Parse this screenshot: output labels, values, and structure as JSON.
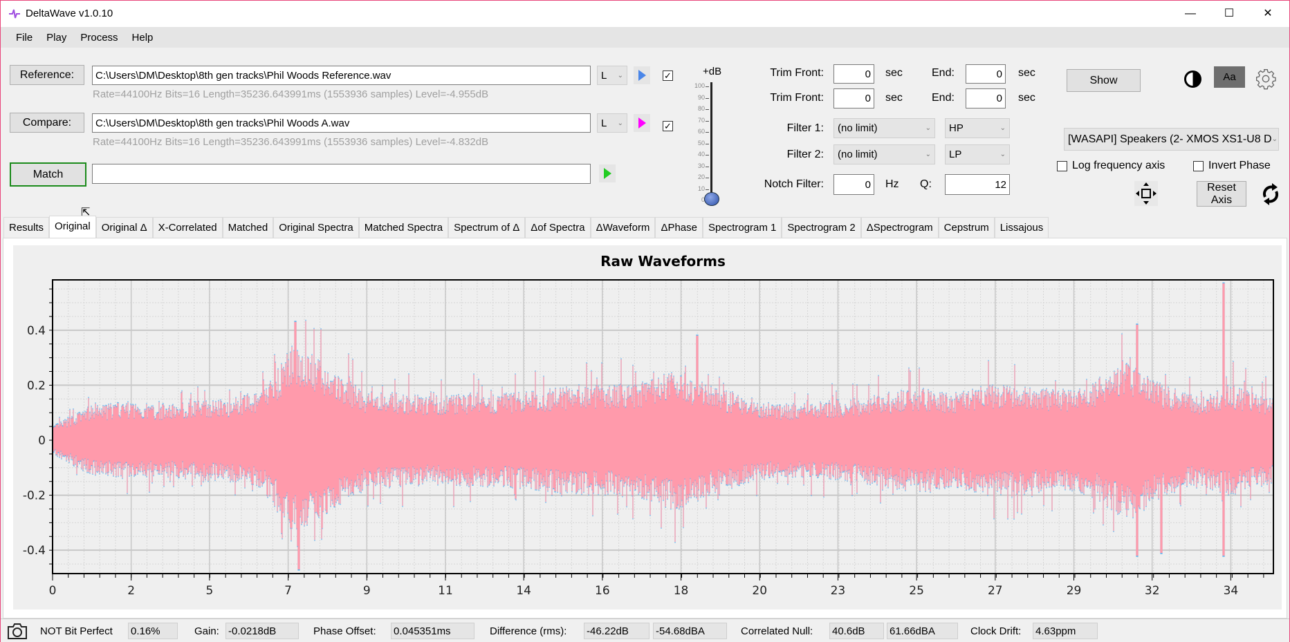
{
  "window": {
    "title": "DeltaWave v1.0.10",
    "minimize": "—",
    "maximize": "☐",
    "close": "✕"
  },
  "menu": [
    "File",
    "Play",
    "Process",
    "Help"
  ],
  "reference": {
    "button": "Reference:",
    "path": "C:\\Users\\DM\\Desktop\\8th gen tracks\\Phil Woods Reference.wav",
    "channel": "L",
    "info": "Rate=44100Hz Bits=16 Length=35236.643991ms (1553936 samples) Level=-4.955dB",
    "checked": true,
    "play_color": "#4a86e8"
  },
  "compare": {
    "button": "Compare:",
    "path": "C:\\Users\\DM\\Desktop\\8th gen tracks\\Phil Woods A.wav",
    "channel": "L",
    "info": "Rate=44100Hz Bits=16 Length=35236.643991ms (1553936 samples) Level=-4.832dB",
    "checked": true,
    "play_color": "#ff00ff"
  },
  "match": {
    "button": "Match",
    "value": "",
    "play_color": "#22cc22"
  },
  "gain_slider": {
    "label": "+dB",
    "ticks": [
      "100",
      "90",
      "80",
      "70",
      "60",
      "50",
      "40",
      "30",
      "20",
      "10",
      "0"
    ],
    "value": 0
  },
  "trim": [
    {
      "label": "Trim Front:",
      "front": "0",
      "unit": "sec",
      "end_label": "End:",
      "end": "0",
      "end_unit": "sec"
    },
    {
      "label": "Trim Front:",
      "front": "0",
      "unit": "sec",
      "end_label": "End:",
      "end": "0",
      "end_unit": "sec"
    }
  ],
  "filter1": {
    "label": "Filter 1:",
    "value": "(no limit)",
    "type": "HP"
  },
  "filter2": {
    "label": "Filter 2:",
    "value": "(no limit)",
    "type": "LP"
  },
  "notch": {
    "label": "Notch Filter:",
    "value": "0",
    "unit": "Hz",
    "q_label": "Q:",
    "q": "12"
  },
  "show_button": "Show",
  "font_button": "Aa",
  "device": "[WASAPI] Speakers (2- XMOS XS1-U8 D",
  "log_freq": {
    "label": "Log frequency axis",
    "checked": false
  },
  "invert_phase": {
    "label": "Invert Phase",
    "checked": false
  },
  "reset_axis": "Reset Axis",
  "tabs": [
    "Results",
    "Original",
    "Original Δ",
    "X-Correlated",
    "Matched",
    "Original Spectra",
    "Matched Spectra",
    "Spectrum of Δ",
    "Δof Spectra",
    "ΔWaveform",
    "ΔPhase",
    "Spectrogram 1",
    "Spectrogram 2",
    "ΔSpectrogram",
    "Cepstrum",
    "Lissajous"
  ],
  "active_tab": 1,
  "chart_data": {
    "type": "area",
    "title": "Raw Waveforms",
    "xlabel": "",
    "ylabel": "",
    "xlim": [
      0,
      35.24
    ],
    "ylim": [
      -0.485,
      0.583
    ],
    "grid": true,
    "x_ticks": [
      0,
      2.27,
      4.53,
      6.8,
      9.07,
      11.34,
      13.6,
      15.87,
      18.14,
      20.41,
      22.67,
      24.94,
      27.21,
      29.48,
      31.74,
      34.01
    ],
    "x_tick_labels": [
      "0",
      "2",
      "5",
      "7",
      "9",
      "11",
      "14",
      "16",
      "18",
      "20",
      "23",
      "25",
      "27",
      "29",
      "32",
      "34"
    ],
    "y_ticks": [
      -0.4,
      -0.2,
      0,
      0.2,
      0.4
    ],
    "y_tick_labels": [
      "-0.4",
      "-0.2",
      "0",
      "0.2",
      "0.4"
    ],
    "peak_envelope_per_second": [
      0.05,
      0.12,
      0.14,
      0.13,
      0.14,
      0.15,
      0.17,
      0.36,
      0.26,
      0.18,
      0.17,
      0.16,
      0.17,
      0.17,
      0.18,
      0.2,
      0.2,
      0.21,
      0.26,
      0.2,
      0.16,
      0.13,
      0.14,
      0.15,
      0.17,
      0.19,
      0.17,
      0.2,
      0.2,
      0.18,
      0.2,
      0.3,
      0.21,
      0.16,
      0.2,
      0.16
    ],
    "peaks": [
      [
        7.0,
        0.43
      ],
      [
        7.1,
        -0.47
      ],
      [
        18.6,
        0.38
      ],
      [
        31.3,
        0.42
      ],
      [
        31.3,
        -0.42
      ],
      [
        32.0,
        -0.41
      ],
      [
        33.8,
        0.57
      ],
      [
        33.8,
        -0.42
      ]
    ],
    "series": [
      {
        "color": "#5ab4f0"
      },
      {
        "color": "#ff9aab"
      }
    ]
  },
  "status": {
    "bit_perfect_label": "NOT Bit Perfect",
    "bit_perfect": "0.16%",
    "gain_label": "Gain:",
    "gain": "-0.0218dB",
    "phase_label": "Phase Offset:",
    "phase": "0.045351ms",
    "diff_label": "Difference (rms):",
    "diff_db": "-46.22dB",
    "diff_dba": "-54.68dBA",
    "null_label": "Correlated Null:",
    "null_db": "40.6dB",
    "null_dba": "61.66dBA",
    "drift_label": "Clock Drift:",
    "drift": "4.63ppm"
  }
}
